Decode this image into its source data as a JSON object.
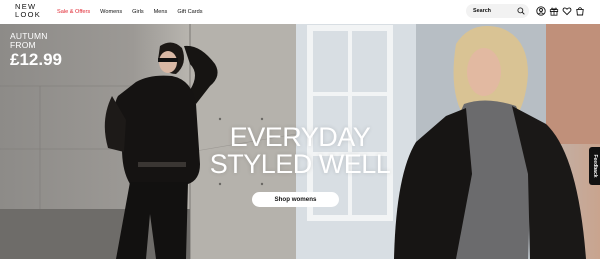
{
  "brand": {
    "line1": "NEW",
    "line2": "LOOK"
  },
  "nav": {
    "items": [
      {
        "label": "Sale & Offers"
      },
      {
        "label": "Womens"
      },
      {
        "label": "Girls"
      },
      {
        "label": "Mens"
      },
      {
        "label": "Gift Cards"
      }
    ]
  },
  "search": {
    "label": "Search"
  },
  "header_icons": [
    "user-icon",
    "gift-icon",
    "heart-icon",
    "bag-icon"
  ],
  "hero": {
    "promo": {
      "line1": "AUTUMN",
      "line2": "FROM",
      "price": "£12.99"
    },
    "headline": {
      "line1": "EVERYDAY",
      "line2": "STYLED WELL"
    },
    "cta": "Shop womens"
  },
  "feedback": "Feedback",
  "colors": {
    "sale": "#e0242f",
    "text": "#111111",
    "search_bg": "#f2f2f2"
  }
}
